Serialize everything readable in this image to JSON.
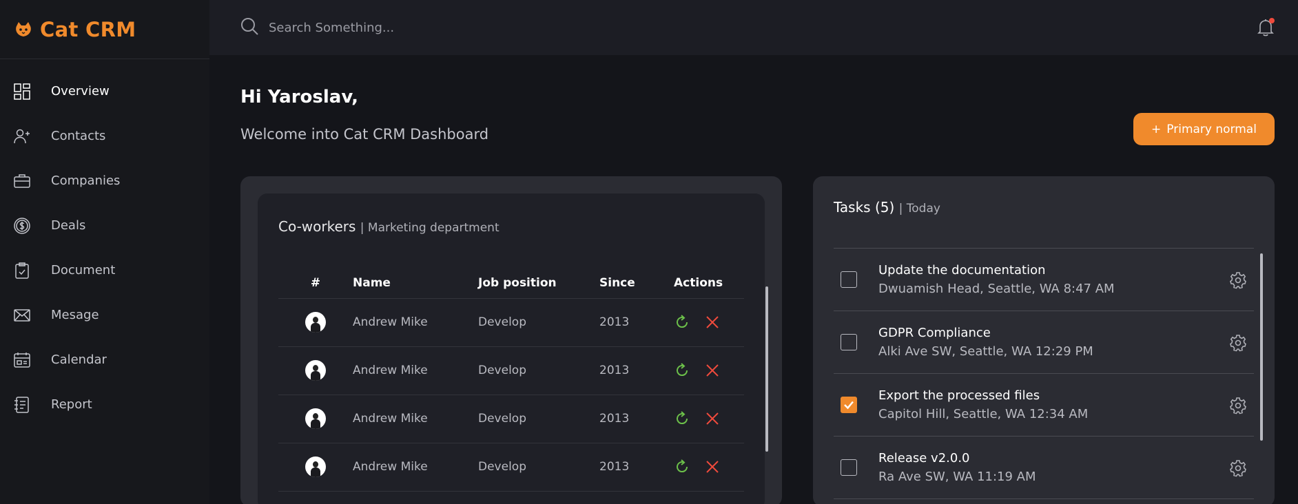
{
  "brand": {
    "name": "Cat CRM",
    "accent": "#f08a2c"
  },
  "search": {
    "placeholder": "Search Something..."
  },
  "sidebar": {
    "items": [
      {
        "label": "Overview",
        "icon": "grid-icon",
        "active": true
      },
      {
        "label": "Contacts",
        "icon": "user-plus-icon"
      },
      {
        "label": "Companies",
        "icon": "briefcase-icon"
      },
      {
        "label": "Deals",
        "icon": "dollar-icon"
      },
      {
        "label": "Document",
        "icon": "clipboard-check-icon"
      },
      {
        "label": "Mesage",
        "icon": "envelope-icon"
      },
      {
        "label": "Calendar",
        "icon": "calendar-icon"
      },
      {
        "label": "Report",
        "icon": "report-icon"
      }
    ]
  },
  "main": {
    "greeting": "Hi Yaroslav,",
    "welcome": "Welcome into Cat CRM Dashboard",
    "primary_button": {
      "icon": "+",
      "label": "Primary normal"
    }
  },
  "coworkers": {
    "title": "Co-workers",
    "subtitle": "| Marketing department",
    "columns": [
      "#",
      "Name",
      "Job position",
      "Since",
      "Actions"
    ],
    "rows": [
      {
        "name": "Andrew Mike",
        "job": "Develop",
        "since": "2013"
      },
      {
        "name": "Andrew Mike",
        "job": "Develop",
        "since": "2013"
      },
      {
        "name": "Andrew Mike",
        "job": "Develop",
        "since": "2013"
      },
      {
        "name": "Andrew Mike",
        "job": "Develop",
        "since": "2013"
      }
    ],
    "action_colors": {
      "refresh": "#6cc04a",
      "delete": "#ef4a3c"
    }
  },
  "tasks": {
    "title": "Tasks (5)",
    "subtitle": "| Today",
    "items": [
      {
        "title": "Update the documentation",
        "meta": "Dwuamish Head, Seattle, WA 8:47 AM",
        "done": false
      },
      {
        "title": "GDPR Compliance",
        "meta": "Alki Ave SW, Seattle, WA 12:29 PM",
        "done": false
      },
      {
        "title": "Export the processed files",
        "meta": "Capitol Hill, Seattle, WA 12:34 AM",
        "done": true
      },
      {
        "title": "Release v2.0.0",
        "meta": "Ra Ave SW, WA 11:19 AM",
        "done": false
      }
    ]
  }
}
